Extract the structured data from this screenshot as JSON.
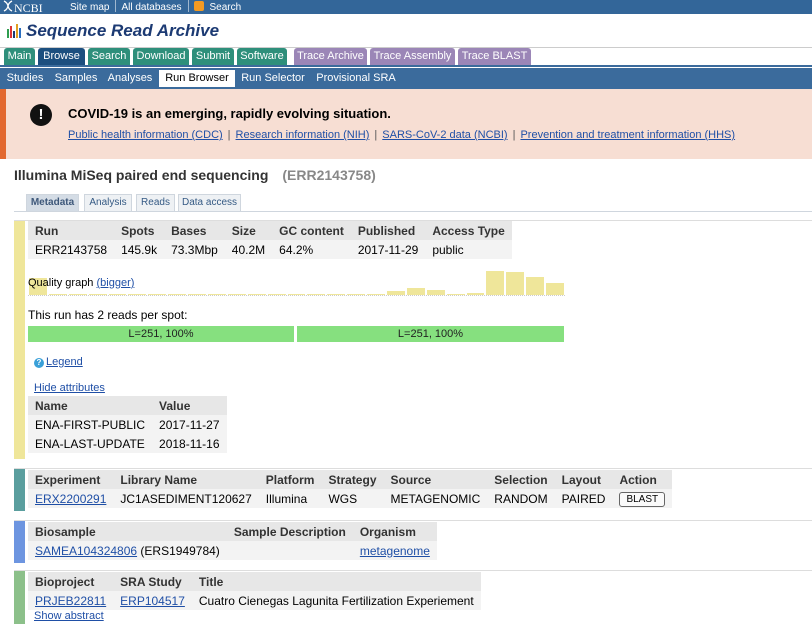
{
  "topbar": {
    "logo": "NCBI",
    "links": [
      "Site map",
      "All databases",
      "Search"
    ]
  },
  "title": "Sequence Read Archive",
  "main_tabs": [
    {
      "label": "Main",
      "style": "green"
    },
    {
      "label": "Browse",
      "style": "active"
    },
    {
      "label": "Search",
      "style": "green"
    },
    {
      "label": "Download",
      "style": "green"
    },
    {
      "label": "Submit",
      "style": "green"
    },
    {
      "label": "Software",
      "style": "green"
    },
    {
      "label": "Trace Archive",
      "style": "purple"
    },
    {
      "label": "Trace Assembly",
      "style": "purple"
    },
    {
      "label": "Trace BLAST",
      "style": "purple"
    }
  ],
  "sub_tabs": [
    {
      "label": "Studies"
    },
    {
      "label": "Samples"
    },
    {
      "label": "Analyses"
    },
    {
      "label": "Run Browser",
      "active": true
    },
    {
      "label": "Run Selector"
    },
    {
      "label": "Provisional SRA"
    }
  ],
  "covid": {
    "icon": "exclamation-icon",
    "headline": "COVID-19 is an emerging, rapidly evolving situation.",
    "links": [
      "Public health information (CDC)",
      "Research information (NIH)",
      "SARS-CoV-2 data (NCBI)",
      "Prevention and treatment information (HHS)"
    ]
  },
  "run_title": {
    "name": "Illumina MiSeq paired end sequencing",
    "accession": "(ERR2143758)"
  },
  "detail_tabs": [
    "Metadata",
    "Analysis",
    "Reads",
    "Data access"
  ],
  "run": {
    "headers": [
      "Run",
      "Spots",
      "Bases",
      "Size",
      "GC content",
      "Published",
      "Access Type"
    ],
    "row": [
      "ERR2143758",
      "145.9k",
      "73.3Mbp",
      "40.2M",
      "64.2%",
      "2017-11-29",
      "public"
    ]
  },
  "quality": {
    "label": "Quality graph",
    "bigger": "(bigger)",
    "levels": [
      0.7,
      0,
      0,
      0,
      0,
      0,
      0,
      0,
      0,
      0,
      0,
      0,
      0,
      0,
      0,
      0,
      0,
      0,
      0.15,
      0.3,
      0.2,
      0,
      0.1,
      1,
      0.95,
      0.75,
      0.5
    ]
  },
  "reads": {
    "text": "This run has 2 reads per spot:",
    "bars": [
      "L=251, 100%",
      "L=251, 100%"
    ]
  },
  "legend": "Legend",
  "hide_attributes": "Hide attributes",
  "attributes": {
    "headers": [
      "Name",
      "Value"
    ],
    "rows": [
      [
        "ENA-FIRST-PUBLIC",
        "2017-11-27"
      ],
      [
        "ENA-LAST-UPDATE",
        "2018-11-16"
      ]
    ]
  },
  "experiment": {
    "headers": [
      "Experiment",
      "Library Name",
      "Platform",
      "Strategy",
      "Source",
      "Selection",
      "Layout",
      "Action"
    ],
    "accession": "ERX2200291",
    "library_name": "JC1ASEDIMENT120627",
    "platform": "Illumina",
    "strategy": "WGS",
    "source": "METAGENOMIC",
    "selection": "RANDOM",
    "layout": "PAIRED",
    "action": "BLAST"
  },
  "biosample": {
    "headers": [
      "Biosample",
      "Sample Description",
      "Organism"
    ],
    "accession": "SAMEA104324806",
    "ers": "(ERS1949784)",
    "description": "",
    "organism": "metagenome"
  },
  "bioproject": {
    "headers": [
      "Bioproject",
      "SRA Study",
      "Title"
    ],
    "accession": "PRJEB22811",
    "study": "ERP104517",
    "title": "Cuatro Cienegas Lagunita Fertilization Experiement",
    "show_abstract": "Show abstract"
  },
  "colors": {
    "section_run": "#efe69a",
    "section_experiment": "#5a9e9e",
    "section_biosample": "#6d95e0",
    "section_bioproject": "#8cc08a",
    "read_bar": "#86e07f",
    "covid_accent": "#e2682f"
  }
}
